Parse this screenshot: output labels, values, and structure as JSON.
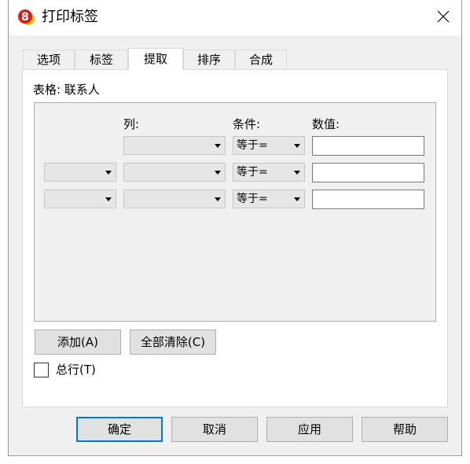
{
  "window": {
    "title": "打印标签",
    "icon": "app-badge-8-icon"
  },
  "tabs": [
    {
      "label": "选项",
      "active": false
    },
    {
      "label": "标签",
      "active": false
    },
    {
      "label": "提取",
      "active": true
    },
    {
      "label": "排序",
      "active": false
    },
    {
      "label": "合成",
      "active": false
    }
  ],
  "panel": {
    "table_label": "表格: 联系人",
    "headers": {
      "column": "列:",
      "condition": "条件:",
      "value": "数值:"
    },
    "rows": [
      {
        "join": null,
        "column": "",
        "condition": "等于=",
        "value": ""
      },
      {
        "join": "",
        "column": "",
        "condition": "等于=",
        "value": ""
      },
      {
        "join": "",
        "column": "",
        "condition": "等于=",
        "value": ""
      }
    ],
    "add_button": "添加(A)",
    "clear_all_button": "全部清除(C)",
    "total_rows_label": "总行(T)",
    "total_rows_checked": false
  },
  "footer": {
    "ok": "确定",
    "cancel": "取消",
    "apply": "应用",
    "help": "帮助"
  },
  "colors": {
    "accent": "#0078d7",
    "icon_red": "#d6201b",
    "icon_yellow": "#f2c200"
  }
}
